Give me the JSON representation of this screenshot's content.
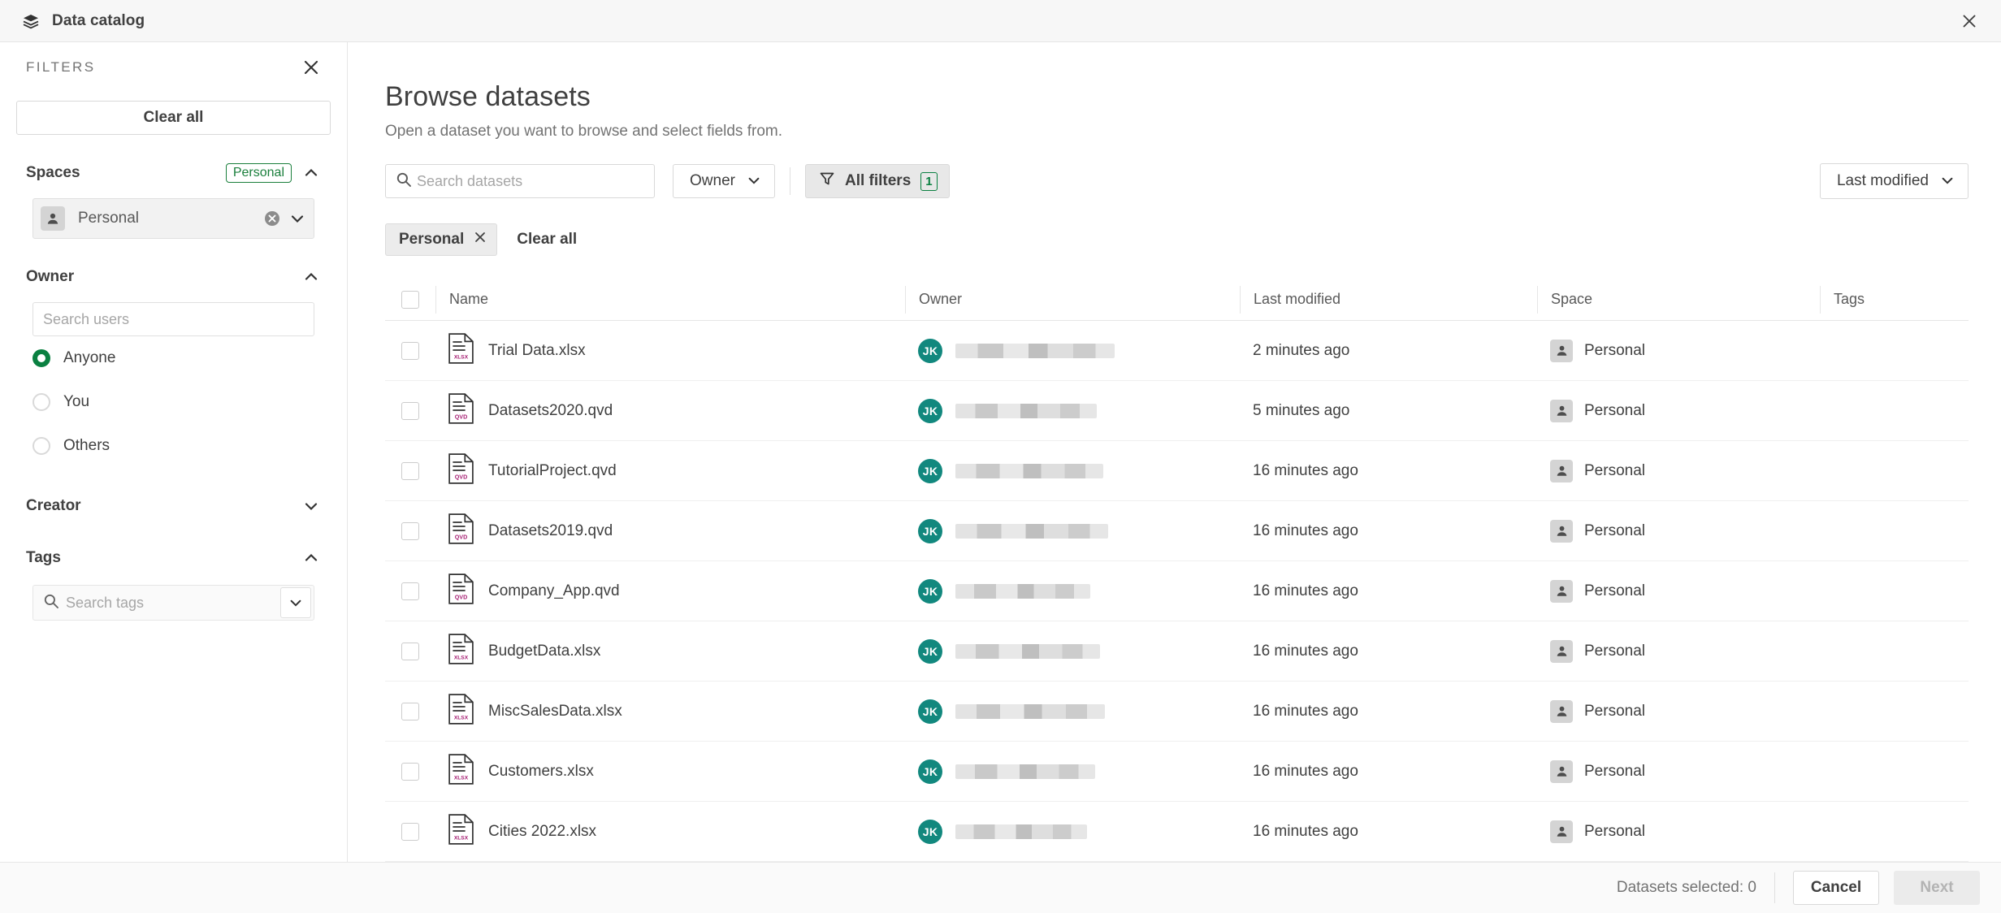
{
  "window": {
    "app_title": "Data catalog",
    "app_icon": "stack-icon",
    "close_icon": "close-icon"
  },
  "colors": {
    "accent_green": "#0a8041",
    "badge_green": "#1a7f3c",
    "avatar_teal": "#12887e",
    "file_label_magenta": "#a61e73",
    "panel_bg": "#ffffff",
    "topbar_bg": "#f7f7f7",
    "footer_bg": "#fafafa"
  },
  "filters_panel": {
    "label": "FILTERS",
    "close_icon": "close-icon",
    "clear_all_label": "Clear all",
    "sections": [
      {
        "title": "Spaces",
        "badge": "Personal",
        "expanded": true,
        "chevron_icon": "chevron-up-icon",
        "selected_space": {
          "label": "Personal",
          "avatar_icon": "person-icon",
          "clear_icon": "clear-circle-icon",
          "chevron_icon": "chevron-down-icon"
        }
      },
      {
        "title": "Owner",
        "expanded": true,
        "chevron_icon": "chevron-up-icon",
        "search_placeholder": "Search users",
        "search_value": "",
        "radios": [
          {
            "label": "Anyone",
            "selected": true
          },
          {
            "label": "You",
            "selected": false
          },
          {
            "label": "Others",
            "selected": false
          }
        ]
      },
      {
        "title": "Creator",
        "expanded": false,
        "chevron_icon": "chevron-down-icon"
      },
      {
        "title": "Tags",
        "expanded": true,
        "chevron_icon": "chevron-up-icon",
        "search_placeholder": "Search tags",
        "search_value": "",
        "search_icon": "search-icon",
        "dropdown_icon": "chevron-down-icon"
      }
    ]
  },
  "main": {
    "title": "Browse datasets",
    "subtitle": "Open a dataset you want to browse and select fields from.",
    "toolbar": {
      "search_placeholder": "Search datasets",
      "search_value": "",
      "search_icon": "search-icon",
      "owner_select_label": "Owner",
      "owner_chevron_icon": "chevron-down-icon",
      "all_filters_label": "All filters",
      "all_filters_icon": "funnel-icon",
      "all_filters_count": "1",
      "sort_label": "Last modified",
      "sort_chevron_icon": "chevron-down-icon"
    },
    "active_filters": {
      "chips": [
        {
          "label": "Personal",
          "remove_icon": "close-icon"
        }
      ],
      "clear_all_label": "Clear all"
    },
    "table": {
      "columns": [
        "Name",
        "Owner",
        "Last modified",
        "Space",
        "Tags"
      ],
      "select_all_checkbox": false,
      "rows": [
        {
          "name": "Trial Data.xlsx",
          "file_type": "XLSX",
          "owner_initials": "JK",
          "owner_redacted": true,
          "last_modified": "2 minutes ago",
          "space": "Personal",
          "tags": ""
        },
        {
          "name": "Datasets2020.qvd",
          "file_type": "QVD",
          "owner_initials": "JK",
          "owner_redacted": true,
          "last_modified": "5 minutes ago",
          "space": "Personal",
          "tags": ""
        },
        {
          "name": "TutorialProject.qvd",
          "file_type": "QVD",
          "owner_initials": "JK",
          "owner_redacted": true,
          "last_modified": "16 minutes ago",
          "space": "Personal",
          "tags": ""
        },
        {
          "name": "Datasets2019.qvd",
          "file_type": "QVD",
          "owner_initials": "JK",
          "owner_redacted": true,
          "last_modified": "16 minutes ago",
          "space": "Personal",
          "tags": ""
        },
        {
          "name": "Company_App.qvd",
          "file_type": "QVD",
          "owner_initials": "JK",
          "owner_redacted": true,
          "last_modified": "16 minutes ago",
          "space": "Personal",
          "tags": ""
        },
        {
          "name": "BudgetData.xlsx",
          "file_type": "XLSX",
          "owner_initials": "JK",
          "owner_redacted": true,
          "last_modified": "16 minutes ago",
          "space": "Personal",
          "tags": ""
        },
        {
          "name": "MiscSalesData.xlsx",
          "file_type": "XLSX",
          "owner_initials": "JK",
          "owner_redacted": true,
          "last_modified": "16 minutes ago",
          "space": "Personal",
          "tags": ""
        },
        {
          "name": "Customers.xlsx",
          "file_type": "XLSX",
          "owner_initials": "JK",
          "owner_redacted": true,
          "last_modified": "16 minutes ago",
          "space": "Personal",
          "tags": ""
        },
        {
          "name": "Cities 2022.xlsx",
          "file_type": "XLSX",
          "owner_initials": "JK",
          "owner_redacted": true,
          "last_modified": "16 minutes ago",
          "space": "Personal",
          "tags": ""
        }
      ]
    }
  },
  "footer": {
    "selected_text": "Datasets selected: 0",
    "cancel_label": "Cancel",
    "next_label": "Next",
    "next_disabled": true
  }
}
